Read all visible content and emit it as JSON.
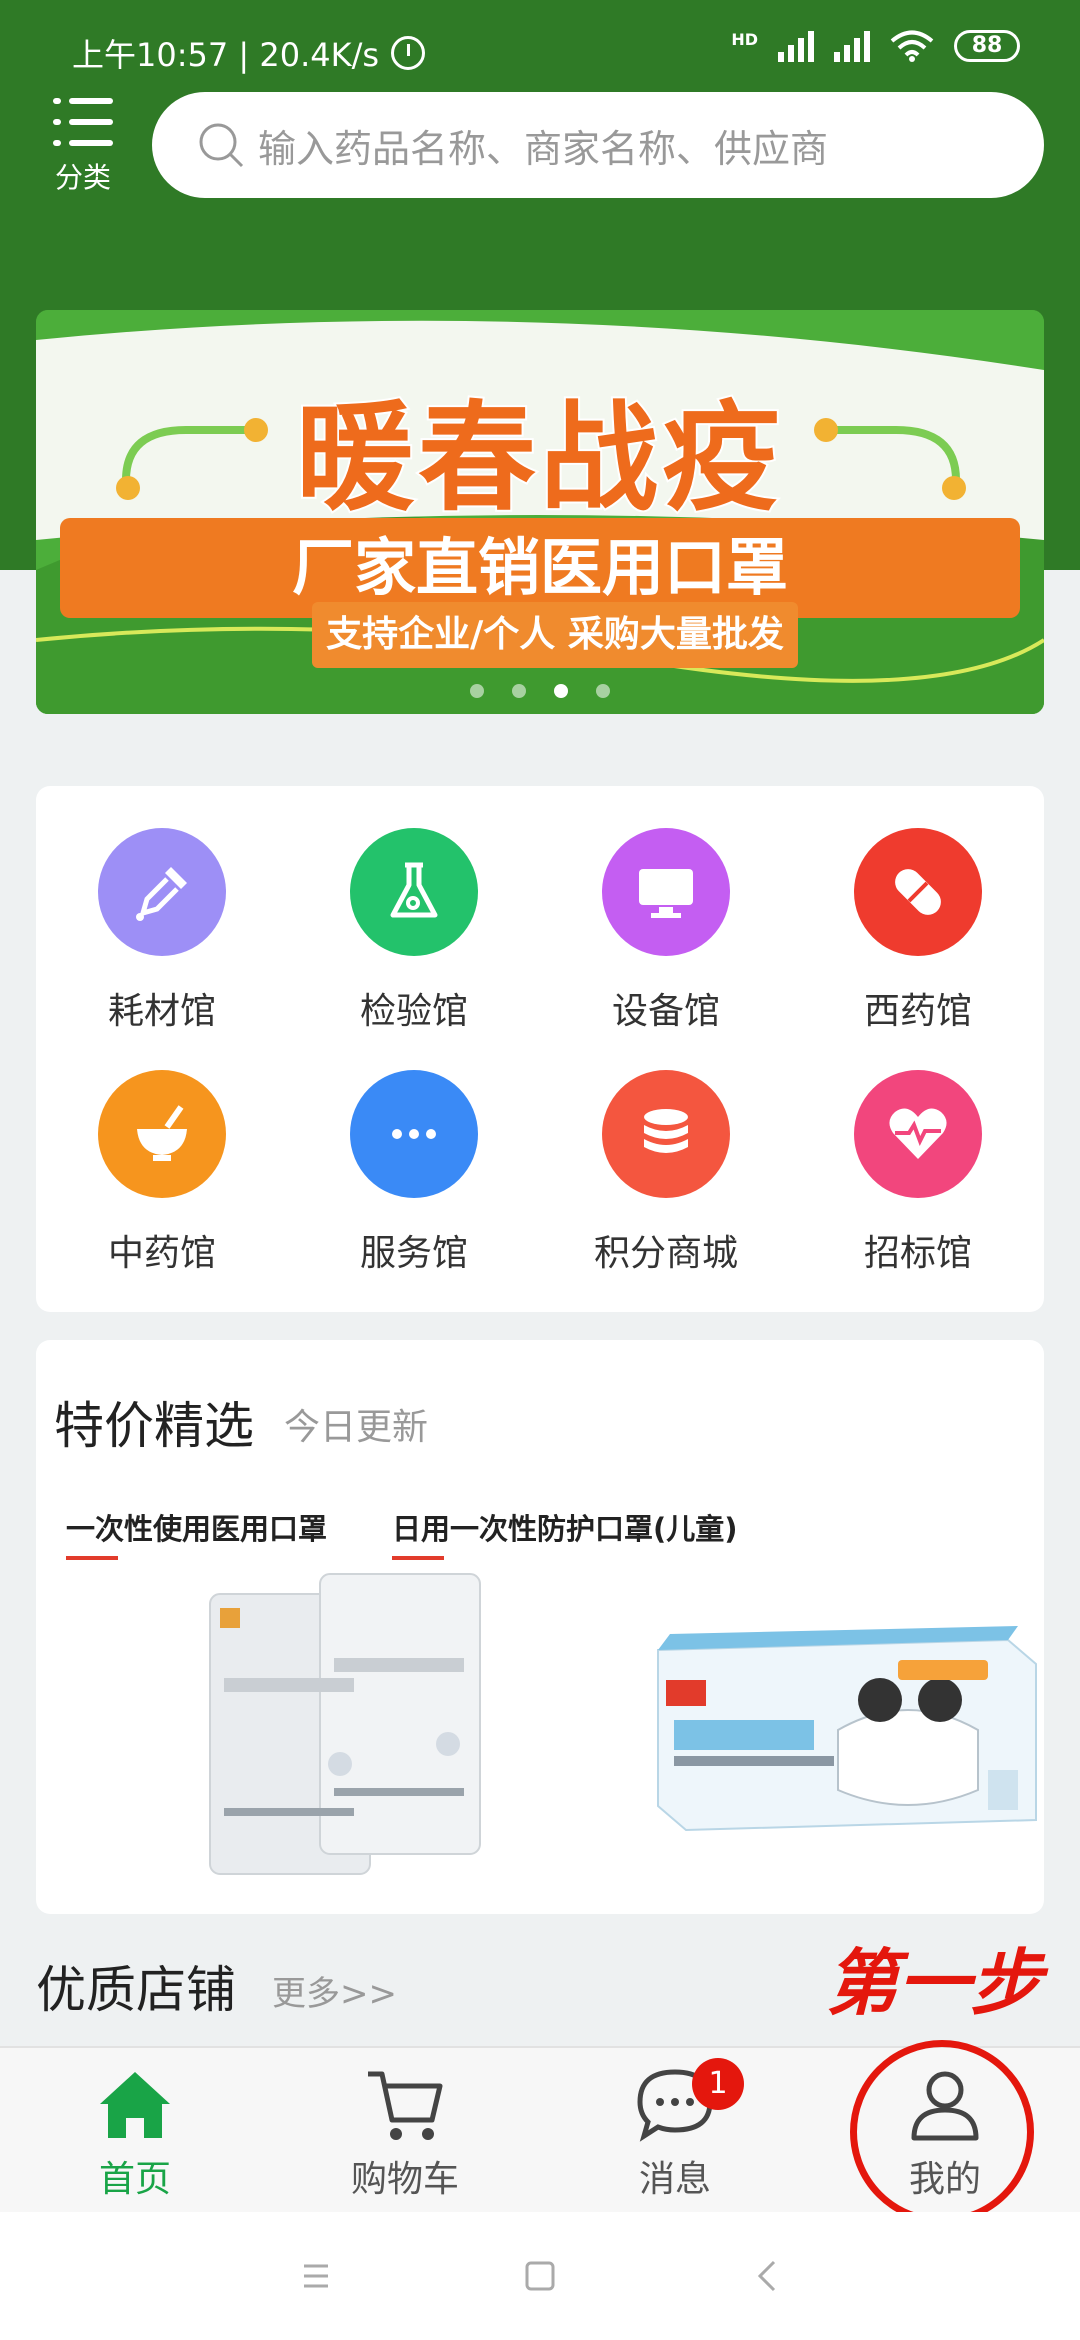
{
  "status_bar": {
    "time_speed": "上午10:57 | 20.4K/s",
    "network_tag": "HD",
    "battery": "88"
  },
  "header": {
    "category_label": "分类",
    "search_placeholder": "输入药品名称、商家名称、供应商"
  },
  "banner": {
    "title": "暖春战疫",
    "strip_text": "厂家直销医用口罩",
    "sub_text": "支持企业/个人 采购大量批发",
    "slide_count": 4,
    "active_slide": 3
  },
  "categories": [
    {
      "label": "耗材馆",
      "icon": "dropper-icon",
      "color": "#9d8ff6"
    },
    {
      "label": "检验馆",
      "icon": "flask-icon",
      "color": "#23c26b"
    },
    {
      "label": "设备馆",
      "icon": "monitor-icon",
      "color": "#c45ef2"
    },
    {
      "label": "西药馆",
      "icon": "pill-icon",
      "color": "#ef3b2e"
    },
    {
      "label": "中药馆",
      "icon": "mortar-icon",
      "color": "#f6951e"
    },
    {
      "label": "服务馆",
      "icon": "more-dots-icon",
      "color": "#3a8af6"
    },
    {
      "label": "积分商城",
      "icon": "coins-icon",
      "color": "#f4563f"
    },
    {
      "label": "招标馆",
      "icon": "heart-pulse-icon",
      "color": "#f2467d"
    }
  ],
  "special": {
    "title": "特价精选",
    "subtitle": "今日更新",
    "products": [
      {
        "name": "一次性使用医用口罩"
      },
      {
        "name": "日用一次性防护口罩(儿童)"
      }
    ]
  },
  "stores": {
    "title": "优质店铺",
    "more": "更多>>"
  },
  "annotation": {
    "step_text": "第一步"
  },
  "bottom_nav": [
    {
      "label": "首页",
      "icon": "home-icon",
      "active": true
    },
    {
      "label": "购物车",
      "icon": "cart-icon"
    },
    {
      "label": "消息",
      "icon": "message-icon",
      "badge": "1"
    },
    {
      "label": "我的",
      "icon": "user-icon"
    }
  ],
  "colors": {
    "header_green": "#2f7a26",
    "active_green": "#19a447",
    "annotation_red": "#e4170d"
  }
}
